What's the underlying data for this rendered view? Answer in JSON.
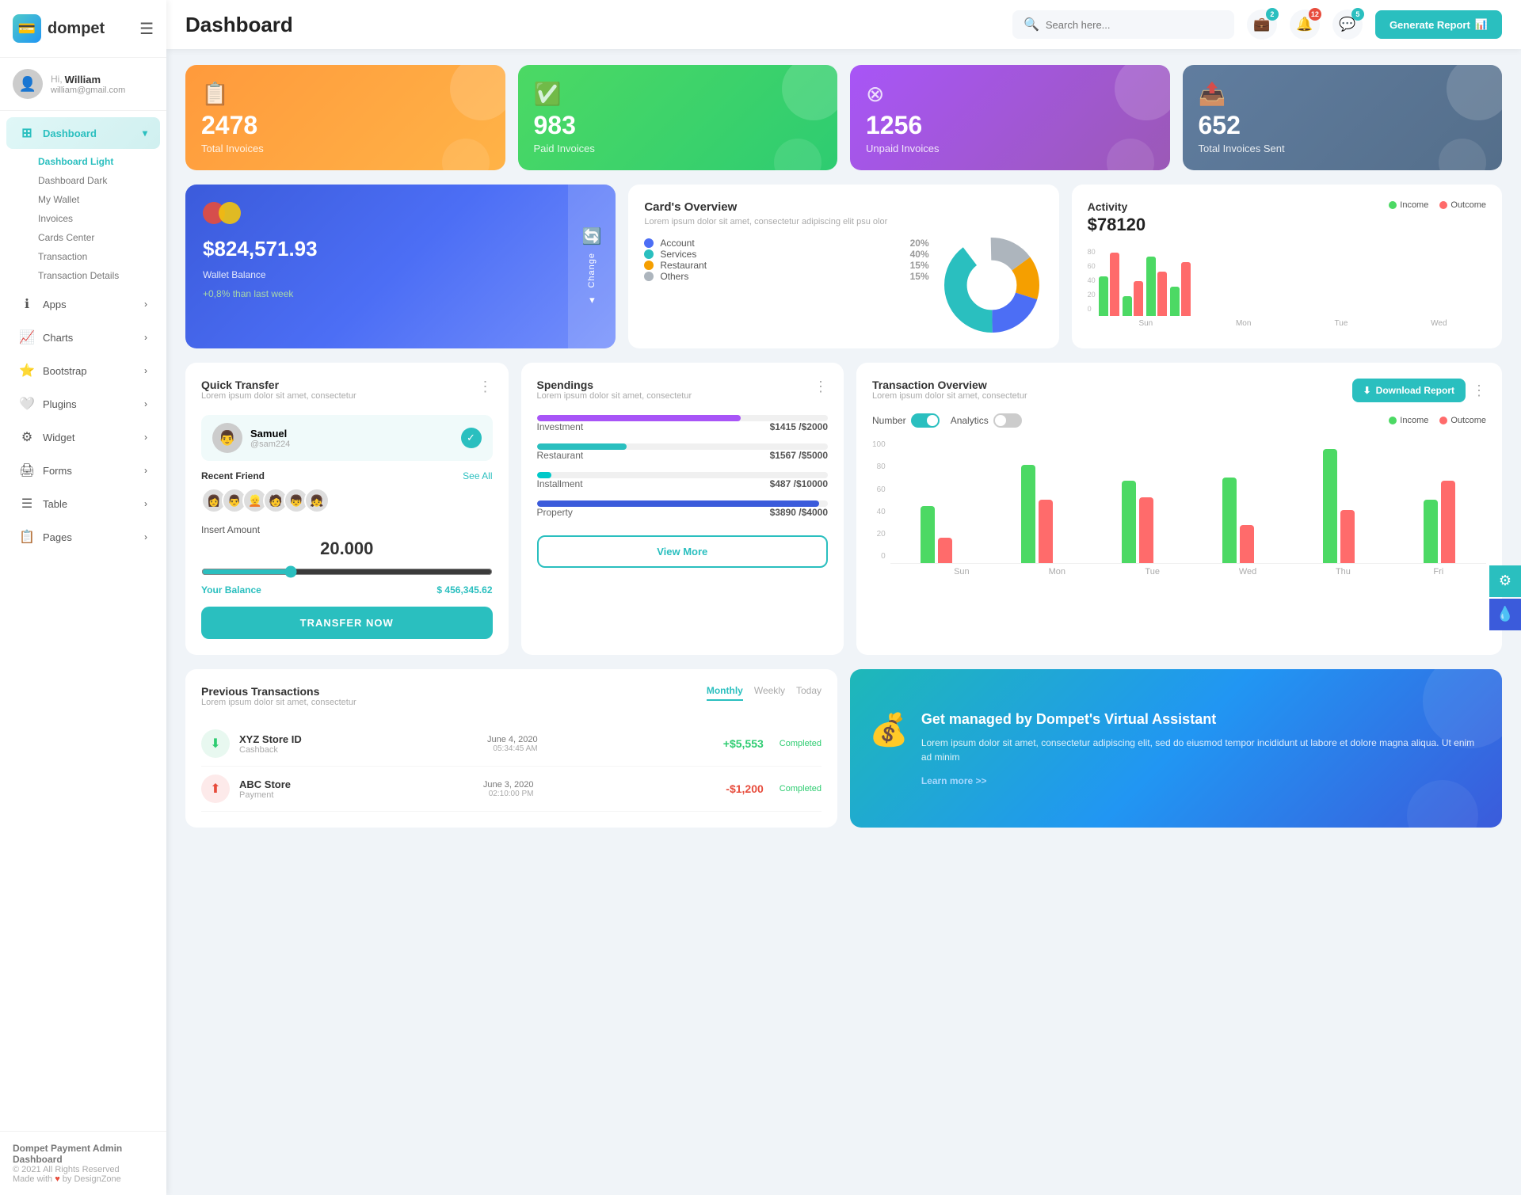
{
  "app": {
    "name": "dompet",
    "logo_icon": "💳"
  },
  "header": {
    "title": "Dashboard",
    "search_placeholder": "Search here...",
    "notifications_count": "2",
    "alerts_count": "12",
    "messages_count": "5",
    "generate_btn": "Generate Report"
  },
  "user": {
    "greeting": "Hi,",
    "name": "William",
    "email": "william@gmail.com",
    "avatar": "👤"
  },
  "sidebar": {
    "nav_items": [
      {
        "id": "dashboard",
        "label": "Dashboard",
        "icon": "⊞",
        "active": true,
        "has_arrow": true
      },
      {
        "id": "apps",
        "label": "Apps",
        "icon": "ℹ",
        "active": false,
        "has_arrow": true
      },
      {
        "id": "charts",
        "label": "Charts",
        "icon": "📈",
        "active": false,
        "has_arrow": true
      },
      {
        "id": "bootstrap",
        "label": "Bootstrap",
        "icon": "⭐",
        "active": false,
        "has_arrow": true
      },
      {
        "id": "plugins",
        "label": "Plugins",
        "icon": "🤍",
        "active": false,
        "has_arrow": true
      },
      {
        "id": "widget",
        "label": "Widget",
        "icon": "⚙",
        "active": false,
        "has_arrow": true
      },
      {
        "id": "forms",
        "label": "Forms",
        "icon": "🖨",
        "active": false,
        "has_arrow": true
      },
      {
        "id": "table",
        "label": "Table",
        "icon": "☰",
        "active": false,
        "has_arrow": true
      },
      {
        "id": "pages",
        "label": "Pages",
        "icon": "📋",
        "active": false,
        "has_arrow": true
      }
    ],
    "sub_items": [
      {
        "label": "Dashboard Light",
        "active": true
      },
      {
        "label": "Dashboard Dark",
        "active": false
      },
      {
        "label": "My Wallet",
        "active": false
      },
      {
        "label": "Invoices",
        "active": false
      },
      {
        "label": "Cards Center",
        "active": false
      },
      {
        "label": "Transaction",
        "active": false
      },
      {
        "label": "Transaction Details",
        "active": false
      }
    ],
    "footer_title": "Dompet Payment Admin Dashboard",
    "footer_copy": "© 2021 All Rights Reserved",
    "footer_made": "Made with",
    "footer_by": "by DesignZone"
  },
  "stats": [
    {
      "id": "total-invoices",
      "num": "2478",
      "label": "Total Invoices",
      "icon": "📋",
      "color": "orange"
    },
    {
      "id": "paid-invoices",
      "num": "983",
      "label": "Paid Invoices",
      "icon": "✅",
      "color": "green"
    },
    {
      "id": "unpaid-invoices",
      "num": "1256",
      "label": "Unpaid Invoices",
      "icon": "⊗",
      "color": "purple"
    },
    {
      "id": "total-sent",
      "num": "652",
      "label": "Total Invoices Sent",
      "icon": "📤",
      "color": "slate"
    }
  ],
  "wallet": {
    "amount": "$824,571.93",
    "label": "Wallet Balance",
    "growth": "+0,8% than last week",
    "change_label": "Change"
  },
  "cards_overview": {
    "title": "Card's Overview",
    "desc": "Lorem ipsum dolor sit amet, consectetur adipiscing elit psu olor",
    "legend": [
      {
        "label": "Account",
        "pct": "20%",
        "color": "#4c6ef5"
      },
      {
        "label": "Services",
        "pct": "40%",
        "color": "#2abfbf"
      },
      {
        "label": "Restaurant",
        "pct": "15%",
        "color": "#f59f00"
      },
      {
        "label": "Others",
        "pct": "15%",
        "color": "#adb5bd"
      }
    ]
  },
  "activity": {
    "title": "Activity",
    "amount": "$78120",
    "income_label": "Income",
    "outcome_label": "Outcome",
    "bars": [
      {
        "day": "Sun",
        "income": 40,
        "outcome": 65
      },
      {
        "day": "Mon",
        "income": 20,
        "outcome": 35
      },
      {
        "day": "Tue",
        "income": 60,
        "outcome": 45
      },
      {
        "day": "Wed",
        "income": 30,
        "outcome": 55
      }
    ]
  },
  "quick_transfer": {
    "title": "Quick Transfer",
    "desc": "Lorem ipsum dolor sit amet, consectetur",
    "contact_name": "Samuel",
    "contact_handle": "@sam224",
    "recent_friends": "Recent Friend",
    "see_all": "See All",
    "amount_label": "Insert Amount",
    "amount": "20.000",
    "balance_label": "Your Balance",
    "balance": "$ 456,345.62",
    "transfer_btn": "TRANSFER NOW",
    "friends": [
      "👩",
      "👨",
      "👩🏻",
      "👦",
      "👧",
      "👩🏽"
    ]
  },
  "spendings": {
    "title": "Spendings",
    "desc": "Lorem ipsum dolor sit amet, consectetur",
    "items": [
      {
        "cat": "Investment",
        "val": "$1415",
        "max": "$2000",
        "pct": 70,
        "color": "#a855f7"
      },
      {
        "cat": "Restaurant",
        "val": "$1567",
        "max": "$5000",
        "pct": 31,
        "color": "#2abfbf"
      },
      {
        "cat": "Installment",
        "val": "$487",
        "max": "$10000",
        "pct": 5,
        "color": "#00c9c9"
      },
      {
        "cat": "Property",
        "val": "$3890",
        "max": "$4000",
        "pct": 97,
        "color": "#3b5bdb"
      }
    ],
    "view_more": "View More"
  },
  "transaction_overview": {
    "title": "Transaction Overview",
    "desc": "Lorem ipsum dolor sit amet, consectetur",
    "download_btn": "Download Report",
    "number_label": "Number",
    "analytics_label": "Analytics",
    "income_label": "Income",
    "outcome_label": "Outcome",
    "bars": [
      {
        "day": "Sun",
        "income": 45,
        "outcome": 20
      },
      {
        "day": "Mon",
        "income": 78,
        "outcome": 50
      },
      {
        "day": "Tue",
        "income": 65,
        "outcome": 52
      },
      {
        "day": "Wed",
        "income": 68,
        "outcome": 30
      },
      {
        "day": "Thu",
        "income": 90,
        "outcome": 42
      },
      {
        "day": "Fri",
        "income": 50,
        "outcome": 65
      }
    ]
  },
  "previous_transactions": {
    "title": "Previous Transactions",
    "desc": "Lorem ipsum dolor sit amet, consectetur",
    "tabs": [
      "Monthly",
      "Weekly",
      "Today"
    ],
    "active_tab": "Monthly",
    "rows": [
      {
        "name": "XYZ Store ID",
        "sub": "Cashback",
        "date": "June 4, 2020",
        "time": "05:34:45 AM",
        "amount": "+$5,553",
        "status": "Completed",
        "positive": true
      },
      {
        "name": "ABC Store",
        "sub": "Payment",
        "date": "June 3, 2020",
        "time": "02:10:00 PM",
        "amount": "-$1,200",
        "status": "Completed",
        "positive": false
      }
    ]
  },
  "virtual_assistant": {
    "title": "Get managed by Dompet's Virtual Assistant",
    "desc": "Lorem ipsum dolor sit amet, consectetur adipiscing elit, sed do eiusmod tempor incididunt ut labore et dolore magna aliqua. Ut enim ad minim",
    "link": "Learn more >>",
    "icon": "💰"
  }
}
